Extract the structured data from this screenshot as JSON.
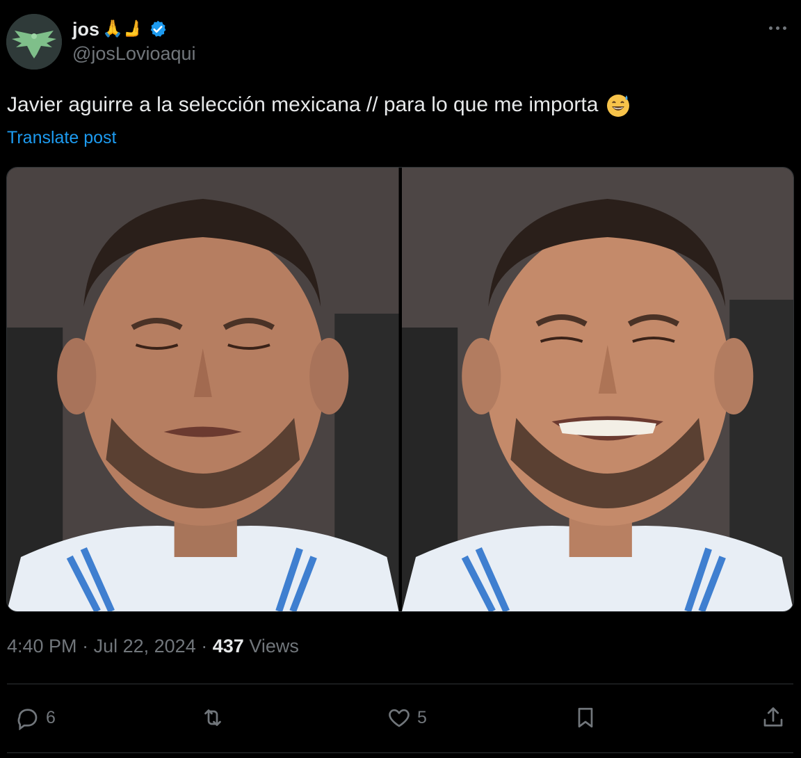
{
  "author": {
    "display_name": "jos",
    "name_emojis": "🙏🫸",
    "handle": "@josLovioaqui",
    "verified": true,
    "avatar_icon": "eagle-icon"
  },
  "post": {
    "text": "Javier aguirre a la selección mexicana // para lo que me importa",
    "text_emoji": "grinning-face-with-sweat-icon",
    "translate_label": "Translate post"
  },
  "media": {
    "count": 2
  },
  "meta": {
    "time": "4:40 PM",
    "separator": "·",
    "date": "Jul 22, 2024",
    "views_count": "437",
    "views_label": "Views"
  },
  "actions": {
    "replies": "6",
    "reposts": "",
    "likes": "5"
  },
  "colors": {
    "background": "#000000",
    "text": "#e7e9ea",
    "secondary": "#71767b",
    "accent": "#1d9bf0"
  }
}
